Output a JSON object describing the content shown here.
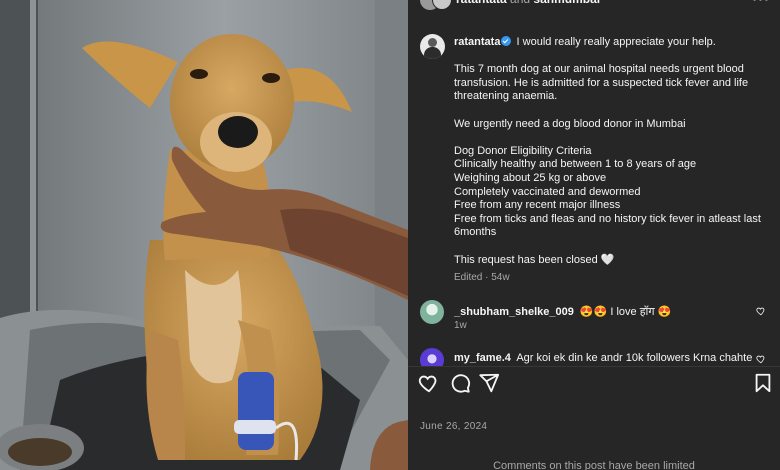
{
  "header": {
    "author_primary": "ratantata",
    "connector": "and",
    "author_secondary": "sanmumbai",
    "more_label": "•••"
  },
  "caption": {
    "username": "ratantata",
    "intro": "I would really really appreciate your help.",
    "paragraph_1": "This 7 month dog at our animal hospital needs urgent blood transfusion. He is admitted for a suspected tick fever and life threatening anaemia.",
    "paragraph_2": "We urgently need a dog blood donor in Mumbai",
    "criteria_title": "Dog Donor Eligibility Criteria",
    "criteria": [
      "Clinically healthy and between 1 to 8 years of age",
      "Weighing about 25 kg or above",
      "Completely vaccinated and dewormed",
      "Free from any recent major illness",
      "Free from ticks and fleas and no history tick fever in atleast last 6months"
    ],
    "closing": "This request has been closed 🤍",
    "meta": "Edited · 54w"
  },
  "comments": [
    {
      "username": "_shubham_shelke_009",
      "text": "😍😍 I love हॉग 😍",
      "meta": "1w"
    },
    {
      "username": "my_fame.4",
      "text": "Agr koi ek din ke andr 10k followers Krna chahte",
      "meta": ""
    }
  ],
  "post_date": "June 26, 2024",
  "comments_limited": "Comments on this post have been limited",
  "icons": {
    "like": "heart-icon",
    "comment": "comment-icon",
    "share": "send-icon",
    "save": "bookmark-icon"
  },
  "colors": {
    "panel_bg": "#262626",
    "text_primary": "#f5f5f5",
    "text_secondary": "#a8a8a8",
    "verified": "#3897f0"
  }
}
